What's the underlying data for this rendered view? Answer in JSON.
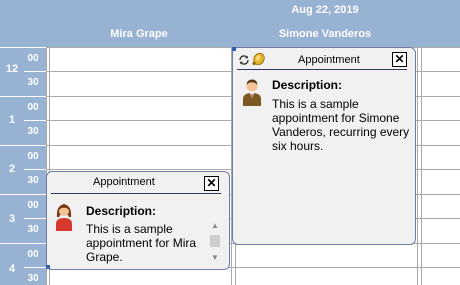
{
  "header": {
    "date": "Aug 22, 2019",
    "resources": [
      "Mira Grape",
      "Simone Vanderos"
    ]
  },
  "timebar": {
    "hours": [
      "12",
      "1",
      "2",
      "3",
      "4"
    ],
    "minutes": [
      "00",
      "30"
    ]
  },
  "popups": {
    "simone": {
      "title": "Appointment",
      "close": "✕",
      "desc_label": "Description:",
      "desc_text": "This is a sample appointment for Simone Vanderos, recurring every six hours.",
      "icons": [
        "recurring-icon",
        "reminder-bell-icon",
        "male-user-icon"
      ]
    },
    "mira": {
      "title": "Appointment",
      "close": "✕",
      "desc_label": "Description:",
      "desc_text": "This is a sample appointment for Mira Grape.",
      "icons": [
        "female-user-icon"
      ],
      "scroll_up": "▲",
      "scroll_down": "▼"
    }
  },
  "colors": {
    "header_bg": "#98b2d3",
    "popup_bg": "#f1f1f1",
    "popup_border": "#6d7da8",
    "grid_line": "#a9a9a9"
  }
}
